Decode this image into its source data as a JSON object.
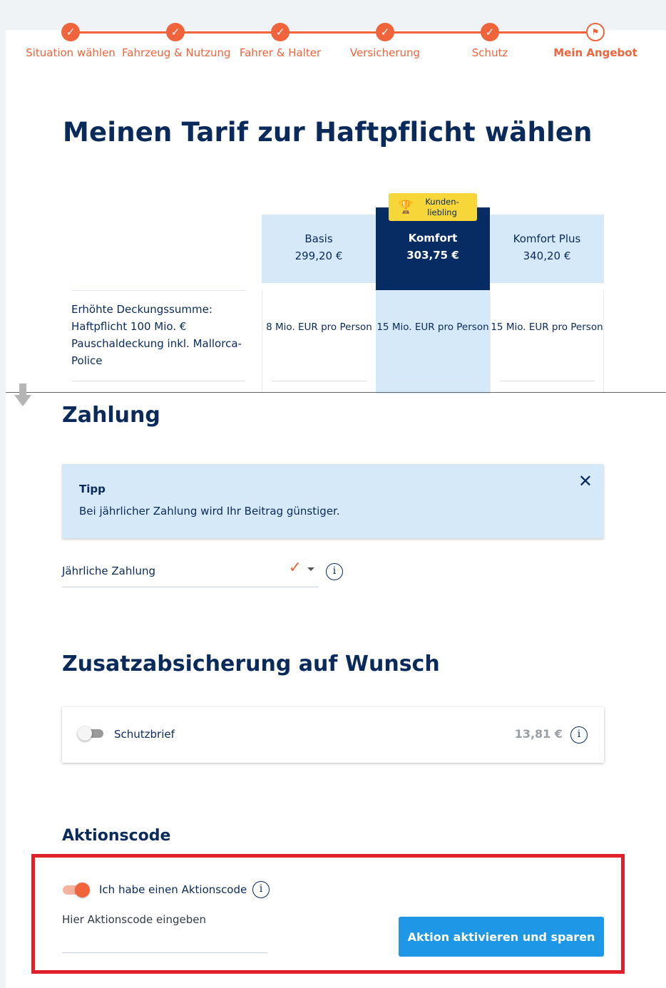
{
  "stepper": {
    "steps": [
      {
        "label": "Situation wählen",
        "state": "done"
      },
      {
        "label": "Fahrzeug & Nutzung",
        "state": "done"
      },
      {
        "label": "Fahrer & Halter",
        "state": "done"
      },
      {
        "label": "Versicherung",
        "state": "done"
      },
      {
        "label": "Schutz",
        "state": "done"
      },
      {
        "label": "Mein Angebot",
        "state": "current"
      }
    ],
    "check_glyph": "✓",
    "flag_glyph": "⚑"
  },
  "page_title": "Meinen Tarif zur Haftpflicht wählen",
  "tariffs": {
    "badge": {
      "icon": "🏆",
      "text": "Kunden-\nliebling"
    },
    "plans": [
      {
        "name": "Basis",
        "price": "299,20 €",
        "cell": "8 Mio. EUR pro Person"
      },
      {
        "name": "Komfort",
        "price": "303,75 €",
        "cell": "15 Mio. EUR pro Person"
      },
      {
        "name": "Komfort Plus",
        "price": "340,20 €",
        "cell": "15 Mio. EUR pro Person"
      }
    ],
    "row_label": "Erhöhte Deckungssumme: Haftpflicht 100 Mio. € Pauschaldeckung inkl. Mallorca-Police"
  },
  "zahlung": {
    "heading": "Zahlung",
    "tip": {
      "title": "Tipp",
      "text": "Bei jährlicher Zahlung wird Ihr Beitrag günstiger.",
      "close": "✕"
    },
    "select_value": "Jährliche Zahlung",
    "check": "✓",
    "info": "i"
  },
  "zusatz": {
    "heading": "Zusatzabsicherung auf Wunsch",
    "addon_label": "Schutzbrief",
    "addon_price": "13,81 €",
    "info": "i"
  },
  "aktion": {
    "heading": "Aktionscode",
    "toggle_label": "Ich habe einen Aktionscode",
    "info": "i",
    "code_label": "Hier Aktionscode eingeben",
    "code_value": "",
    "button_label": "Aktion aktivieren und sparen"
  },
  "colors": {
    "accent": "#f0643c",
    "navy": "#062c63",
    "light_blue": "#d6e9f8",
    "cta_blue": "#1e97e6",
    "highlight_red": "#e0202a"
  }
}
